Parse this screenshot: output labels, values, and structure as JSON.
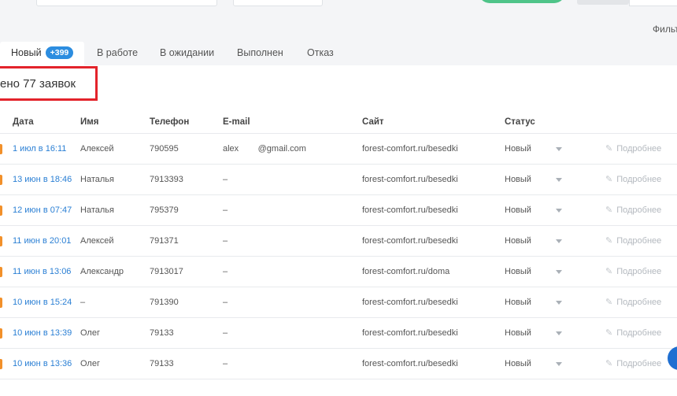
{
  "header": {
    "filter_label": "Фильт"
  },
  "tabs": [
    {
      "label": "Новый",
      "badge": "+399",
      "active": true
    },
    {
      "label": "В работе"
    },
    {
      "label": "В ожидании"
    },
    {
      "label": "Выполнен"
    },
    {
      "label": "Отказ"
    }
  ],
  "summary": {
    "count_text": "ено 77 заявок"
  },
  "table": {
    "columns": [
      "Дата",
      "Имя",
      "Телефон",
      "E-mail",
      "Сайт",
      "Статус"
    ],
    "more_label": "Подробнее",
    "rows": [
      {
        "date": "1 июл в 16:11",
        "name": "Алексей",
        "phone": "790595",
        "email": "alex        @gmail.com",
        "site": "forest-comfort.ru/besedki",
        "status": "Новый"
      },
      {
        "date": "13 июн в 18:46",
        "name": "Наталья",
        "phone": "7913393",
        "email": "–",
        "site": "forest-comfort.ru/besedki",
        "status": "Новый"
      },
      {
        "date": "12 июн в 07:47",
        "name": "Наталья",
        "phone": "795379",
        "email": "–",
        "site": "forest-comfort.ru/besedki",
        "status": "Новый"
      },
      {
        "date": "11 июн в 20:01",
        "name": "Алексей",
        "phone": "791371",
        "email": "–",
        "site": "forest-comfort.ru/besedki",
        "status": "Новый"
      },
      {
        "date": "11 июн в 13:06",
        "name": "Александр",
        "phone": "7913017",
        "email": "–",
        "site": "forest-comfort.ru/doma",
        "status": "Новый"
      },
      {
        "date": "10 июн в 15:24",
        "name": "–",
        "phone": "791390",
        "email": "–",
        "site": "forest-comfort.ru/besedki",
        "status": "Новый"
      },
      {
        "date": "10 июн в 13:39",
        "name": "Олег",
        "phone": "79133",
        "email": "–",
        "site": "forest-comfort.ru/besedki",
        "status": "Новый"
      },
      {
        "date": "10 июн в 13:36",
        "name": "Олег",
        "phone": "79133",
        "email": "–",
        "site": "forest-comfort.ru/besedki",
        "status": "Новый"
      }
    ]
  }
}
